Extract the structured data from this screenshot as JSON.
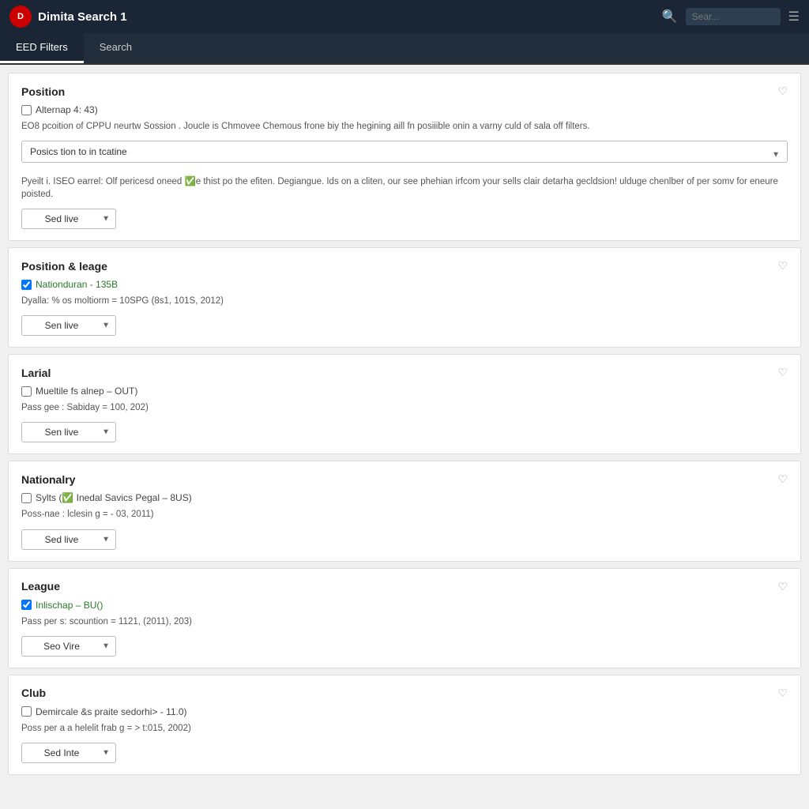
{
  "header": {
    "logo_text": "D",
    "title": "Dimita Search 1",
    "search_placeholder": "Sear...",
    "icon_search": "🔍",
    "icon_menu": "☰"
  },
  "nav": {
    "tabs": [
      {
        "id": "eed-filters",
        "label": "EED Filters",
        "active": true
      },
      {
        "id": "search",
        "label": "Search",
        "active": false
      }
    ]
  },
  "sections": [
    {
      "id": "position",
      "title": "Position",
      "heart": "♡",
      "checkbox_checked": false,
      "checkbox_label": "Alternap 4: 43)",
      "description": "EO8 pcoition of CPPU neurtw Sossion . Joucle is Chmovee Chemous frone biy the hegining aill fn posiiible onin a varny culd of sala off filters.",
      "has_select": true,
      "select_label": "Posics tion to in tcatine",
      "select_type": "dropdown_full",
      "extra_text": "Pyeilt i. ISEO earrel: Olf pericesd oneed ✅e thist po the efiten. Degiangue. Ids on a cliten, our see phehian irfcom your sells clair detarha gecldsion! ulduge chenlber of per somv for eneure poisted.",
      "btn_label": "Sed live"
    },
    {
      "id": "position-league",
      "title": "Position & leage",
      "heart": "♡",
      "checkbox_checked": true,
      "checkbox_label": "Nationduran - 135B",
      "description": "Dyalla: % os moltiorm = 10SPG (8s1, 101S, 2012)",
      "btn_label": "Sen live"
    },
    {
      "id": "larial",
      "title": "Larial",
      "heart": "♡",
      "checkbox_checked": false,
      "checkbox_label": "Mueltile fs alnep – OUT)",
      "description": "Pass gee : Sabiday = 100, 202)",
      "btn_label": "Sen live"
    },
    {
      "id": "nationalry",
      "title": "Nationalry",
      "heart": "♡",
      "checkbox_checked": false,
      "checkbox_label": "Sylts (✅ Inedal Savics Pegal – 8US)",
      "description": "Poss-nae : lclesin g = - 03, 2011)",
      "btn_label": "Sed live"
    },
    {
      "id": "league",
      "title": "League",
      "heart": "♡",
      "checkbox_checked": true,
      "checkbox_label": "Inlischap – BU()",
      "description": "Pass per s: scountion = 1121, (2011), 203)",
      "btn_label": "Seo Vire"
    },
    {
      "id": "club",
      "title": "Club",
      "heart": "♡",
      "checkbox_checked": false,
      "checkbox_label": "Demircale &s praite sedorhi> - 11.0)",
      "description": "Poss per a a helelit frab g = > t:015, 2002)",
      "btn_label": "Sed Inte"
    }
  ]
}
